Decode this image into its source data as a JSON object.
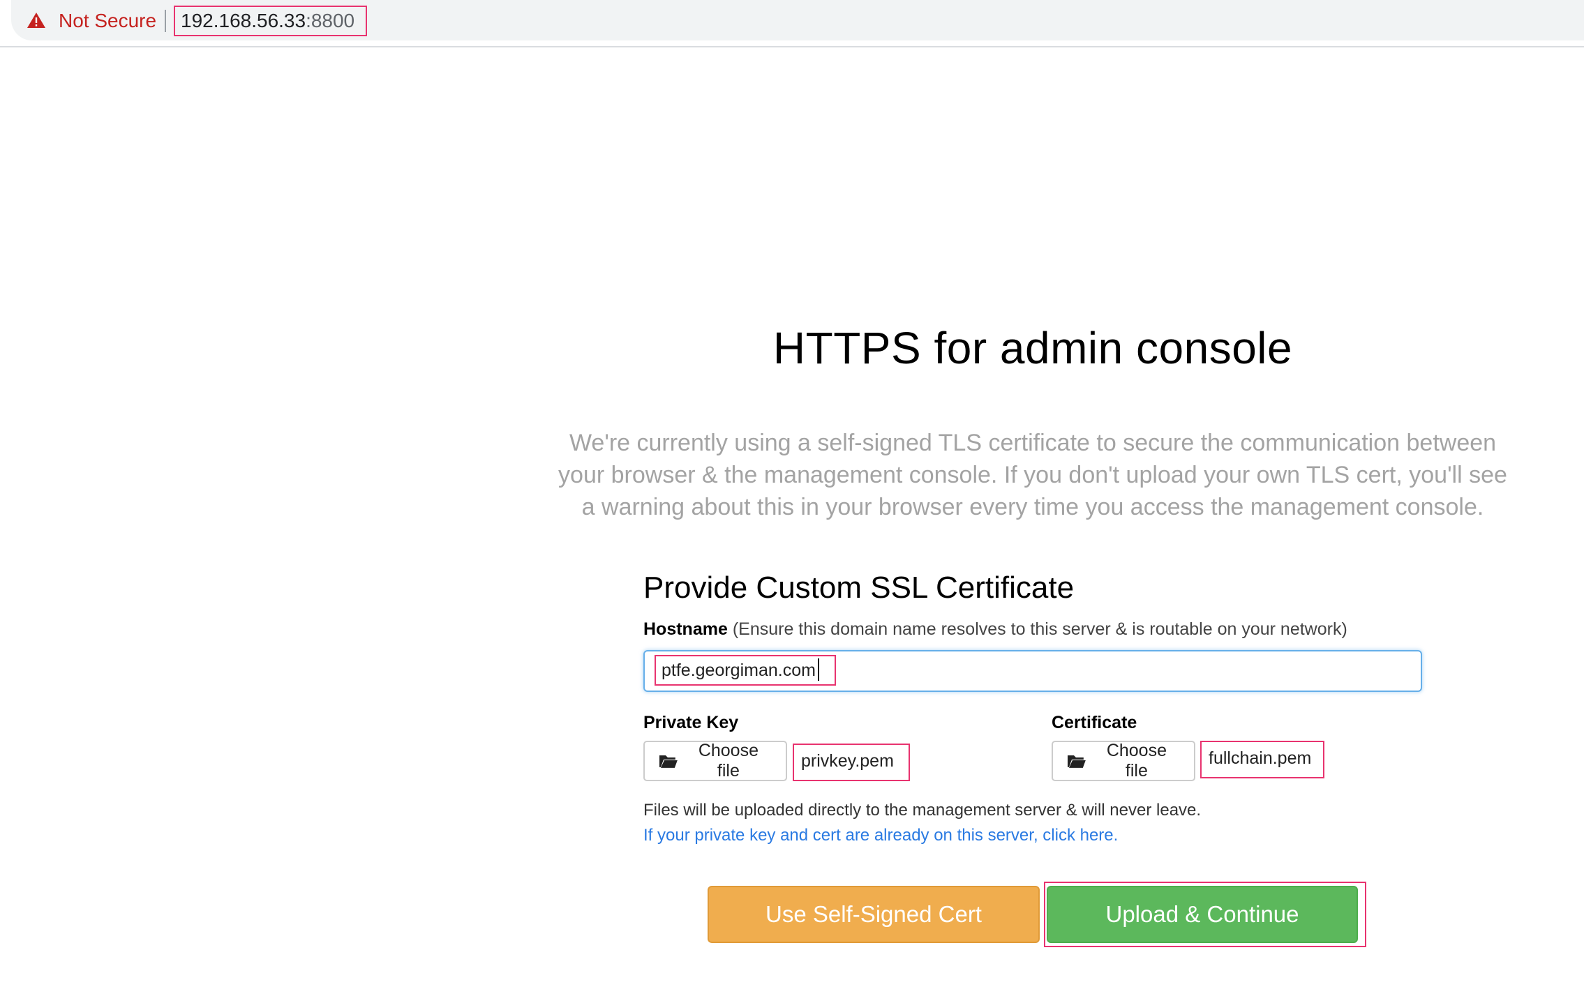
{
  "browser": {
    "security_label": "Not Secure",
    "url_host": "192.168.56.33",
    "url_port": ":8800"
  },
  "page": {
    "title": "HTTPS for admin console",
    "intro": "We're currently using a self-signed TLS certificate to secure the communication between your browser & the management console. If you don't upload your own TLS cert, you'll see a warning about this in your browser every time you access the management console."
  },
  "form": {
    "section_title": "Provide Custom SSL Certificate",
    "hostname_label": "Hostname",
    "hostname_hint": "(Ensure this domain name resolves to this server & is routable on your network)",
    "hostname_value": "ptfe.georgiman.com",
    "private_key": {
      "label": "Private Key",
      "button": "Choose file",
      "file": "privkey.pem"
    },
    "certificate": {
      "label": "Certificate",
      "button": "Choose file",
      "file": "fullchain.pem"
    },
    "upload_note": "Files will be uploaded directly to the management server & will never leave.",
    "server_link": "If your private key and cert are already on this server, click here."
  },
  "actions": {
    "self_signed": "Use Self-Signed Cert",
    "upload": "Upload & Continue"
  },
  "colors": {
    "warning": "#c5221f",
    "highlight": "#e8336f",
    "orange_button": "#f0ad4e",
    "green_button": "#5cb85c",
    "link": "#2a7ae2"
  }
}
